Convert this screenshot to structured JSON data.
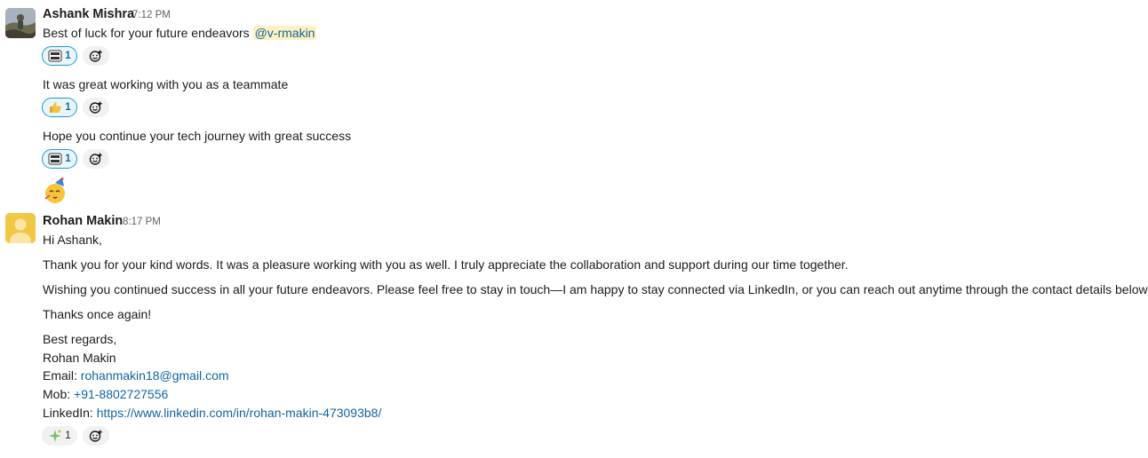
{
  "messages": [
    {
      "sender": "Ashank Mishra",
      "time": "7:12 PM",
      "lines": [
        {
          "text": "Best of luck for your future endeavors ",
          "mention": "@v-rmakin",
          "reaction": {
            "emoji_icon": "thank-you-emoji",
            "count": "1",
            "active": true
          }
        },
        {
          "text": "It was great working with you as a teammate",
          "reaction": {
            "emoji_icon": "thumbs-up-emoji",
            "count": "1",
            "active": true
          }
        },
        {
          "text": "Hope you continue your tech journey with great success",
          "reaction": {
            "emoji_icon": "thank-you-emoji",
            "count": "1",
            "active": true
          }
        }
      ],
      "standalone_emoji": "partying-face-emoji"
    },
    {
      "sender": "Rohan Makin",
      "time": "8:17 PM",
      "greeting": "Hi Ashank,",
      "paragraph1": "Thank you for your kind words. It was a pleasure working with you as well. I truly appreciate the collaboration and support during our time together.",
      "paragraph2": "Wishing you continued success in all your future endeavors. Please feel free to stay in touch—I am happy to stay connected via LinkedIn, or you can reach out anytime through the contact details below.",
      "thanks": "Thanks once again!",
      "signoff": "Best regards,",
      "name": "Rohan Makin",
      "email_label": "Email: ",
      "email": "rohanmakin18@gmail.com",
      "mob_label": "Mob: ",
      "mob": "+91-8802727556",
      "linkedin_label": "LinkedIn: ",
      "linkedin": "https://www.linkedin.com/in/rohan-makin-473093b8/",
      "reaction": {
        "emoji_icon": "sparkle-emoji",
        "count": "1",
        "active": false
      }
    }
  ],
  "icons": {
    "add_reaction": "add-reaction-icon"
  },
  "colors": {
    "link": "#1264a3",
    "mention_bg": "#fdf2bf",
    "reaction_active_border": "#1d9bd1",
    "reaction_active_bg": "#e8f5fa"
  }
}
